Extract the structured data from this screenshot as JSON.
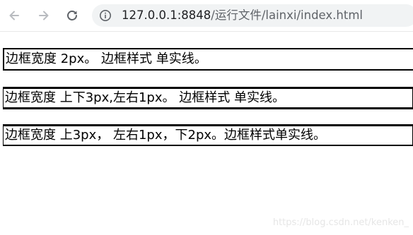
{
  "browser": {
    "url_host": "127.0.0.1:8848",
    "url_path": "/运行文件/lainxi/index.html",
    "back_icon": "arrow-left-icon",
    "forward_icon": "arrow-right-icon",
    "reload_icon": "reload-icon",
    "info_icon": "info-icon"
  },
  "content": {
    "lines": [
      "边框宽度 2px。 边框样式 单实线。",
      "边框宽度 上下3px,左右1px。 边框样式 单实线。",
      "边框宽度 上3px， 左右1px，下2px。边框样式单实线。"
    ],
    "border_color": "#000000"
  },
  "watermark": "https://blog.csdn.net/kenken_"
}
